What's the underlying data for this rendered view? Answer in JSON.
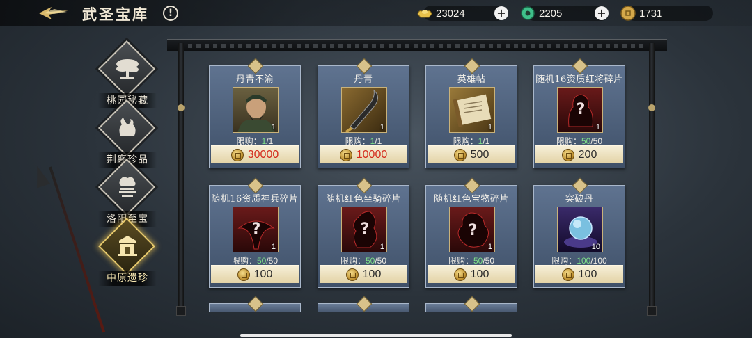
{
  "header": {
    "title": "武圣宝库",
    "info_label": "!"
  },
  "currencies": [
    {
      "name": "gold-ingot",
      "value": "23024",
      "color": "#e8c14a"
    },
    {
      "name": "jade",
      "value": "2205",
      "color": "#3fbf8a"
    },
    {
      "name": "coin",
      "value": "1731",
      "color": "#d4a84a"
    }
  ],
  "plus_label": "+",
  "nav": {
    "items": [
      {
        "label": "桃园秘藏",
        "icon": "tree-icon",
        "active": false
      },
      {
        "label": "荆襄珍品",
        "icon": "vase-icon",
        "active": false
      },
      {
        "label": "洛阳至宝",
        "icon": "beast-icon",
        "active": false
      },
      {
        "label": "中原遗珍",
        "icon": "gate-icon",
        "active": true
      }
    ]
  },
  "shop": {
    "limit_prefix": "限购：",
    "items": [
      {
        "name": "丹青不渝",
        "image": "general-portrait-icon",
        "qty": "1",
        "limit_cur": "1",
        "limit_max": "1",
        "price": "30000",
        "price_red": true
      },
      {
        "name": "丹青",
        "image": "blade-icon",
        "qty": "1",
        "limit_cur": "1",
        "limit_max": "1",
        "price": "10000",
        "price_red": true
      },
      {
        "name": "英雄帖",
        "image": "scroll-icon",
        "qty": "1",
        "limit_cur": "1",
        "limit_max": "1",
        "price": "500",
        "price_red": false
      },
      {
        "name": "随机16资质红将碎片",
        "image": "mystery-general-icon",
        "qty": "1",
        "limit_cur": "50",
        "limit_max": "50",
        "price": "200",
        "price_red": false
      },
      {
        "name": "随机16资质神兵碎片",
        "image": "mystery-weapon-icon",
        "qty": "1",
        "limit_cur": "50",
        "limit_max": "50",
        "price": "100",
        "price_red": false
      },
      {
        "name": "随机红色坐骑碎片",
        "image": "mystery-mount-icon",
        "qty": "1",
        "limit_cur": "50",
        "limit_max": "50",
        "price": "100",
        "price_red": false
      },
      {
        "name": "随机红色宝物碎片",
        "image": "mystery-treasure-icon",
        "qty": "1",
        "limit_cur": "50",
        "limit_max": "50",
        "price": "100",
        "price_red": false
      },
      {
        "name": "突破丹",
        "image": "orb-icon",
        "qty": "10",
        "limit_cur": "100",
        "limit_max": "100",
        "price": "100",
        "price_red": false
      }
    ]
  }
}
